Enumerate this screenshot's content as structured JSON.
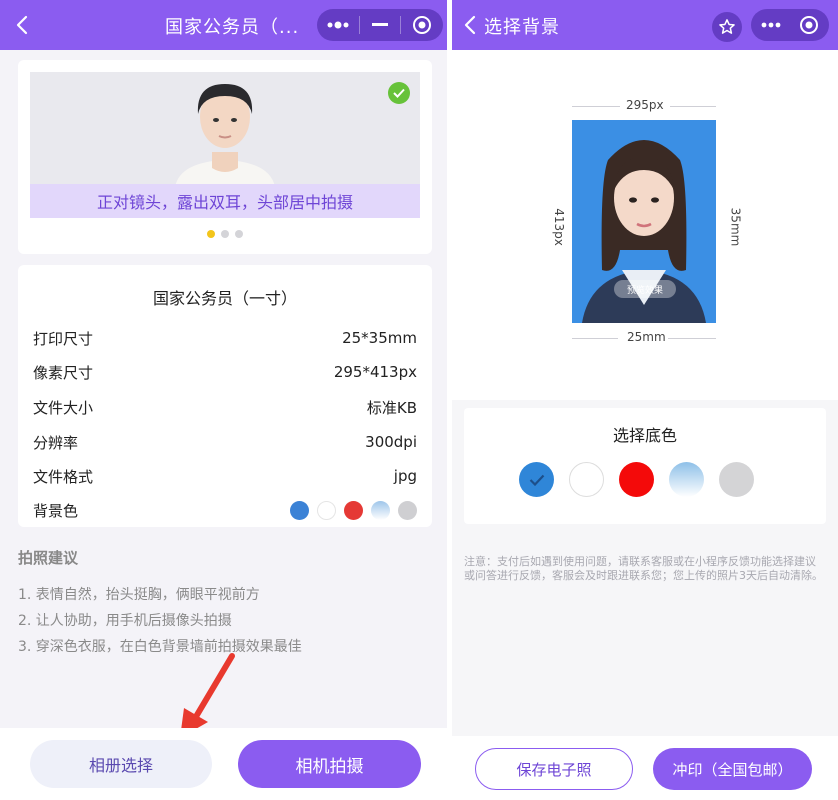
{
  "left": {
    "nav": {
      "title": "国家公务员（..."
    },
    "sample": {
      "caption": "正对镜头，露出双耳，头部居中拍摄"
    },
    "spec": {
      "title": "国家公务员（一寸）",
      "rows": [
        {
          "label": "打印尺寸",
          "value": "25*35mm"
        },
        {
          "label": "像素尺寸",
          "value": "295*413px"
        },
        {
          "label": "文件大小",
          "value": "标准KB"
        },
        {
          "label": "分辨率",
          "value": "300dpi"
        },
        {
          "label": "文件格式",
          "value": "jpg"
        },
        {
          "label": "背景色",
          "value": ""
        }
      ],
      "bg_colors": [
        "#3b82d6",
        "#ffffff",
        "#e53935",
        "#9ec6ea",
        "#cfcfd2"
      ]
    },
    "tips": {
      "title": "拍照建议",
      "items": [
        "1. 表情自然，抬头挺胸，俩眼平视前方",
        "2. 让人协助，用手机后摄像头拍摄",
        "3. 穿深色衣服，在白色背景墙前拍摄效果最佳"
      ]
    },
    "buttons": {
      "album": "相册选择",
      "camera": "相机拍摄"
    }
  },
  "right": {
    "nav": {
      "title": "选择背景"
    },
    "dimensions": {
      "width_px": "295px",
      "height_px": "413px",
      "width_mm": "25mm",
      "height_mm": "35mm"
    },
    "watermark": "预览效果",
    "color_picker": {
      "title": "选择底色",
      "options": [
        "#2f86d8",
        "#ffffff",
        "#f40a0a",
        "#8ec0e8",
        "#d4d4d6"
      ],
      "selected": 0
    },
    "notice": "注意：支付后如遇到使用问题，请联系客服或在小程序反馈功能选择建议或问答进行反馈，客服会及时跟进联系您；您上传的照片3天后自动清除。",
    "buttons": {
      "save": "保存电子照",
      "print": "冲印（全国包邮）"
    }
  },
  "colors": {
    "accent": "#8b5cf0",
    "caption_bg": "#e2d7fb",
    "success": "#67c23a"
  }
}
